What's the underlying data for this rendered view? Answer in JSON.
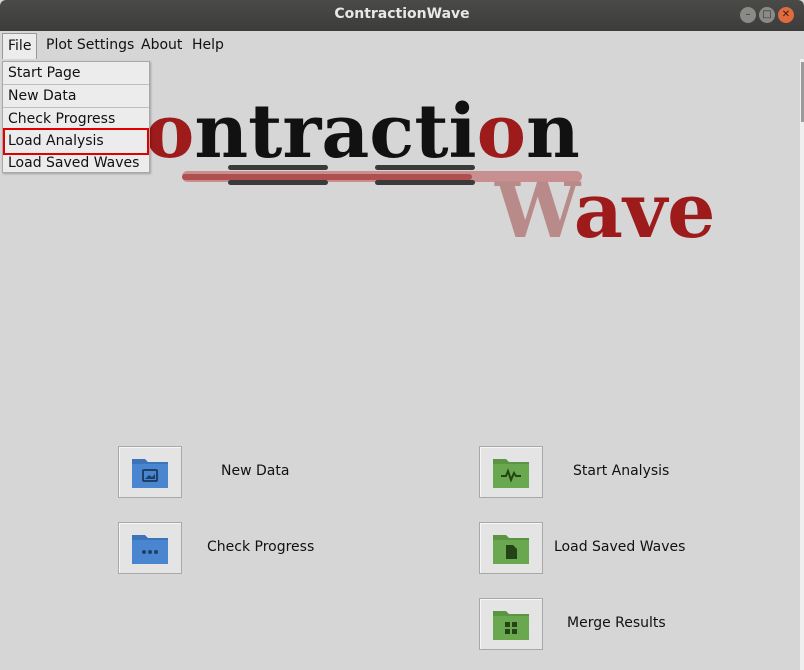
{
  "window": {
    "title": "ContractionWave"
  },
  "menubar": {
    "items": [
      {
        "label": "File"
      },
      {
        "label": "Plot Settings"
      },
      {
        "label": "About"
      },
      {
        "label": "Help"
      }
    ]
  },
  "file_menu": {
    "items": [
      {
        "label": "Start Page"
      },
      {
        "label": "New Data"
      },
      {
        "label": "Check Progress"
      },
      {
        "label": "Load Analysis"
      },
      {
        "label": "Load Saved Waves"
      }
    ]
  },
  "logo": {
    "line1": "ontraction",
    "line2": "Wave"
  },
  "actions": {
    "new_data": "New Data",
    "check_progress": "Check Progress",
    "start_analysis": "Start Analysis",
    "load_saved_waves": "Load Saved Waves",
    "merge_results": "Merge Results"
  },
  "colors": {
    "blue_folder": "#4a86d0",
    "green_folder": "#6aa84f",
    "logo_red": "#9e1b1b",
    "highlight": "#e00000"
  }
}
